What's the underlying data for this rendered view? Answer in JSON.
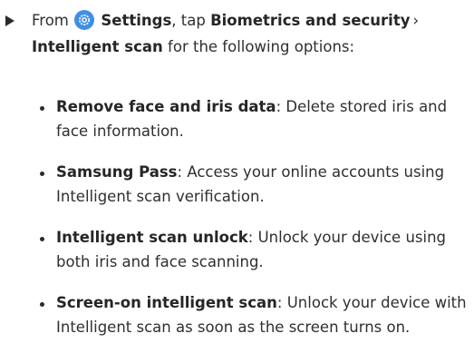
{
  "step": {
    "prefix": "From",
    "settings_icon": "settings-gear-icon",
    "settings_label": "Settings",
    "middle": ", tap",
    "biometrics_label": "Biometrics and security",
    "chevron": "›",
    "intelligent_label": "Intelligent scan",
    "suffix": "for the following options:"
  },
  "options": [
    {
      "term": "Remove face and iris data",
      "desc": ": Delete stored iris and face information."
    },
    {
      "term": "Samsung Pass",
      "desc": ": Access your online accounts using Intelligent scan verification."
    },
    {
      "term": "Intelligent scan unlock",
      "desc": ": Unlock your device using both iris and face scanning."
    },
    {
      "term": "Screen-on intelligent scan",
      "desc": ": Unlock your device with Intelligent scan as soon as the screen turns on."
    }
  ]
}
